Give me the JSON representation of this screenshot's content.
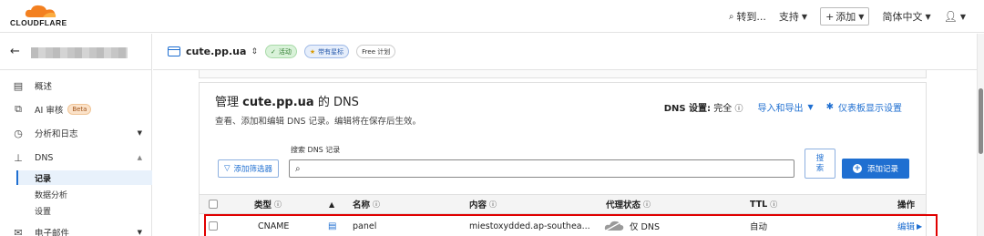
{
  "topbar": {
    "logo_text": "CLOUDFLARE",
    "goto_label": "转到...",
    "support_label": "支持",
    "add_label": "添加",
    "language_label": "简体中文"
  },
  "sidebar": {
    "items": [
      {
        "label": "概述",
        "icon": "document-icon"
      },
      {
        "label": "AI 审核",
        "icon": "ai-audit-icon",
        "badge": "Beta"
      },
      {
        "label": "分析和日志",
        "icon": "analytics-icon"
      },
      {
        "label": "DNS",
        "icon": "dns-icon"
      },
      {
        "label": "电子邮件",
        "icon": "email-icon"
      }
    ],
    "dns_subitems": [
      "记录",
      "数据分析",
      "设置"
    ]
  },
  "domain_bar": {
    "domain": "cute.pp.ua",
    "status_badge": "活动",
    "star_badge": "带有星标",
    "plan_badge": "Free 计划"
  },
  "dns_card": {
    "title_prefix": "管理",
    "title_domain": "cute.pp.ua",
    "title_suffix": "的 DNS",
    "subtitle": "查看、添加和编辑 DNS 记录。编辑将在保存后生效。",
    "settings_label": "DNS 设置:",
    "settings_value": "完全",
    "import_export_label": "导入和导出",
    "dashboard_settings_label": "仪表板显示设置",
    "filter_button": "添加筛选器",
    "search_label": "搜索 DNS 记录",
    "search_button_line1": "搜",
    "search_button_line2": "索",
    "add_record_button": "添加记录"
  },
  "table": {
    "columns": {
      "type": "类型",
      "name": "名称",
      "content": "内容",
      "proxy": "代理状态",
      "ttl": "TTL",
      "actions": "操作"
    },
    "rows": [
      {
        "type": "CNAME",
        "name": "panel",
        "content": "miestoxydded.ap-southea...",
        "proxy": "仅 DNS",
        "ttl": "自动",
        "action": "编辑"
      }
    ]
  },
  "colors": {
    "accent": "#1f6fd1",
    "cloudflare_orange": "#f38020",
    "highlight_border": "#e00000"
  }
}
